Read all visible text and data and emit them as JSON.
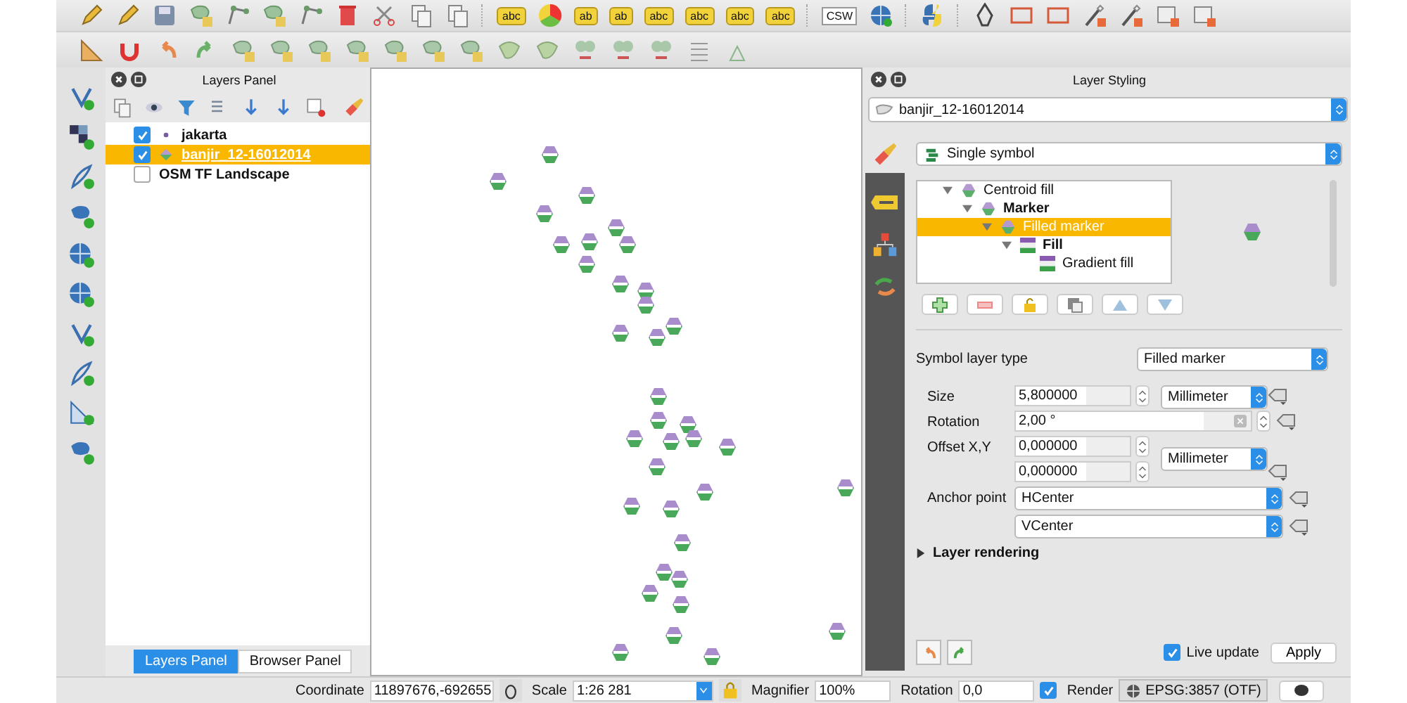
{
  "main_toolbar": {
    "tags": [
      "abc",
      "ab",
      "ab",
      "abc",
      "abc",
      "abc",
      "abc"
    ],
    "csw": "CSW"
  },
  "layers_panel": {
    "title": "Layers Panel",
    "layers": [
      {
        "name": "jakarta",
        "kind": "point",
        "checked": true,
        "selected": false
      },
      {
        "name": "banjir_12-16012014",
        "kind": "marker",
        "checked": true,
        "selected": true
      },
      {
        "name": "OSM TF Landscape",
        "kind": "raster",
        "checked": false,
        "selected": false
      }
    ],
    "tabs": [
      {
        "label": "Layers Panel",
        "selected": true
      },
      {
        "label": "Browser Panel",
        "selected": false
      }
    ]
  },
  "layer_styling": {
    "title": "Layer Styling",
    "layer": "banjir_12-16012014",
    "renderer": "Single symbol",
    "symbol_tree": [
      {
        "label": "Centroid fill",
        "bold": false,
        "selected": false,
        "expanded": true,
        "children": [
          {
            "label": "Marker",
            "bold": true,
            "selected": false,
            "expanded": true,
            "children": [
              {
                "label": "Filled marker",
                "bold": false,
                "selected": true,
                "expanded": true,
                "children": [
                  {
                    "label": "Fill",
                    "bold": true,
                    "selected": false,
                    "expanded": true,
                    "children": [
                      {
                        "label": "Gradient fill",
                        "bold": false,
                        "selected": false
                      }
                    ]
                  }
                ]
              }
            ]
          }
        ]
      }
    ],
    "symbol_layer_type_label": "Symbol layer type",
    "symbol_layer_type": "Filled marker",
    "properties": [
      {
        "kind": "spin",
        "label": "Size",
        "values": [
          "5,800000"
        ],
        "unit": "Millimeter"
      },
      {
        "kind": "clearable",
        "label": "Rotation",
        "values": [
          "2,00 °"
        ]
      },
      {
        "kind": "spin",
        "label": "Offset X,Y",
        "values": [
          "0,000000",
          "0,000000"
        ],
        "unit": "Millimeter"
      },
      {
        "kind": "combo",
        "label": "Anchor point",
        "values": [
          "HCenter",
          "VCenter"
        ]
      }
    ],
    "layer_rendering": {
      "label": "Layer rendering",
      "expanded": false
    },
    "live_update": {
      "label": "Live update",
      "checked": true
    },
    "apply": "Apply"
  },
  "status_bar": {
    "coordinate_label": "Coordinate",
    "coordinate": "11897676,-692655",
    "scale_label": "Scale",
    "scale": "1:26 281",
    "magnifier_label": "Magnifier",
    "magnifier": "100%",
    "rotation_label": "Rotation",
    "rotation": "0,0",
    "render": {
      "label": "Render",
      "checked": true
    },
    "crs": "EPSG:3857 (OTF)"
  }
}
